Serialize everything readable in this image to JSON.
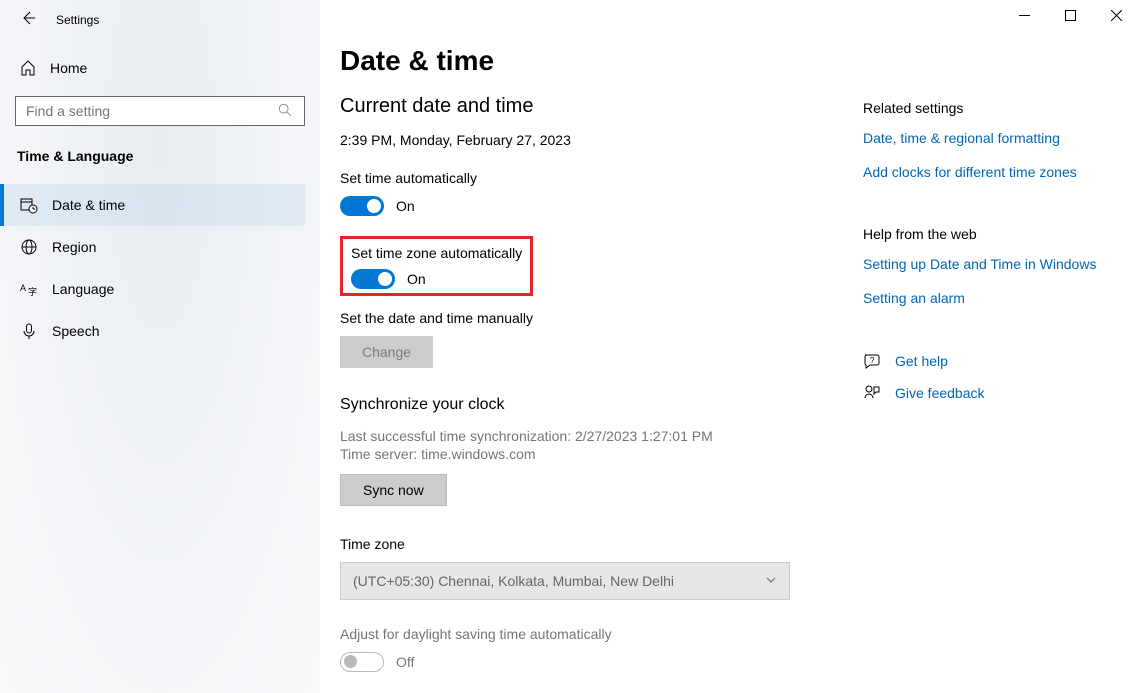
{
  "titlebar": {
    "title": "Settings"
  },
  "sidebar": {
    "home": "Home",
    "search_placeholder": "Find a setting",
    "section": "Time & Language",
    "items": [
      {
        "label": "Date & time"
      },
      {
        "label": "Region"
      },
      {
        "label": "Language"
      },
      {
        "label": "Speech"
      }
    ]
  },
  "main": {
    "title": "Date & time",
    "current_heading": "Current date and time",
    "current_value": "2:39 PM, Monday, February 27, 2023",
    "set_time_auto_label": "Set time automatically",
    "set_time_auto_state": "On",
    "set_tz_auto_label": "Set time zone automatically",
    "set_tz_auto_state": "On",
    "manual_label": "Set the date and time manually",
    "change_btn": "Change",
    "sync_heading": "Synchronize your clock",
    "sync_last": "Last successful time synchronization: 2/27/2023 1:27:01 PM",
    "sync_server": "Time server: time.windows.com",
    "sync_btn": "Sync now",
    "tz_label": "Time zone",
    "tz_value": "(UTC+05:30) Chennai, Kolkata, Mumbai, New Delhi",
    "dst_label": "Adjust for daylight saving time automatically",
    "dst_state": "Off"
  },
  "right": {
    "related_heading": "Related settings",
    "related_links": [
      "Date, time & regional formatting",
      "Add clocks for different time zones"
    ],
    "help_heading": "Help from the web",
    "help_links": [
      "Setting up Date and Time in Windows",
      "Setting an alarm"
    ],
    "get_help": "Get help",
    "feedback": "Give feedback"
  }
}
